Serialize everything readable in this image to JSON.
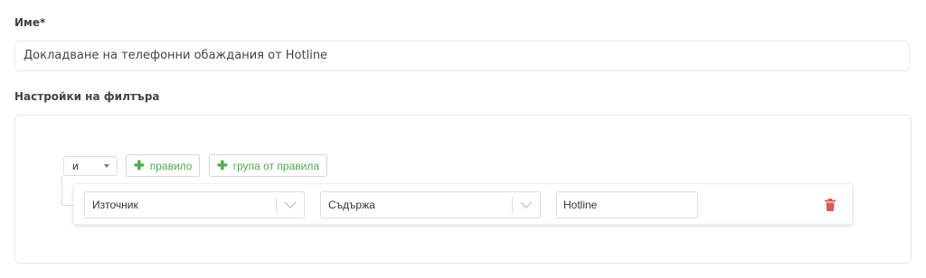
{
  "form": {
    "name_label": "Име*",
    "name_value": "Докладване на телефонни обаждания от Hotline",
    "filter_label": "Настройки на филтъра"
  },
  "query_builder": {
    "condition": "и",
    "add_rule_label": "правило",
    "add_group_label": "група от правила",
    "rule": {
      "field": "Източник",
      "operator": "Съдържа",
      "value": "Hotline"
    }
  },
  "colors": {
    "accent_green": "#4cae4c",
    "delete_red": "#e05555"
  },
  "icons": {
    "add": "plus-icon",
    "dropdown": "chevron-down-icon",
    "delete": "trash-icon"
  }
}
